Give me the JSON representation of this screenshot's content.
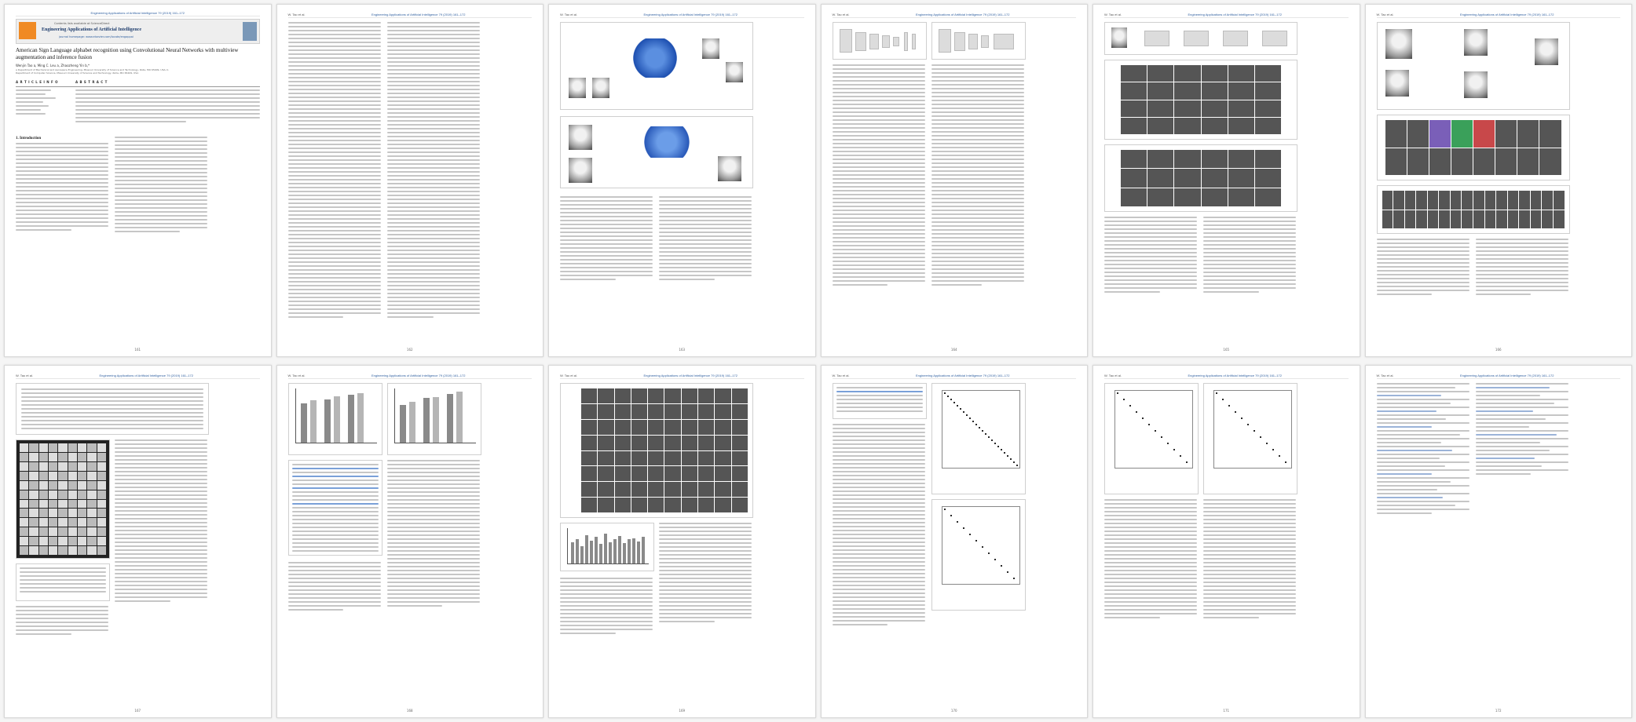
{
  "document": {
    "running_header": "Engineering Applications of Artificial Intelligence 79 (2019) 161–172",
    "running_author": "W. Tao et al.",
    "journal": {
      "contents_line": "Contents lists available at ScienceDirect",
      "name": "Engineering Applications of Artificial Intelligence",
      "homepage": "journal homepage: www.elsevier.com/locate/engappai"
    },
    "title": "American Sign Language alphabet recognition using Convolutional Neural Networks with multiview augmentation and inference fusion",
    "authors": "Wenjin Tao a, Ming C. Leu a, Zhaozheng Yin b,*",
    "affiliations": "a Department of Mechanical and Aerospace Engineering, Missouri University of Science and Technology, Rolla, MO 65409, USA; b Department of Computer Science, Missouri University of Science and Technology, Rolla, MO 65409, USA",
    "article_info_label": "A R T I C L E   I N F O",
    "abstract_label": "A B S T R A C T",
    "intro_heading": "1. Introduction",
    "page_numbers": [
      "161",
      "162",
      "163",
      "164",
      "165",
      "166",
      "167",
      "168",
      "169",
      "170",
      "171",
      "172"
    ]
  }
}
